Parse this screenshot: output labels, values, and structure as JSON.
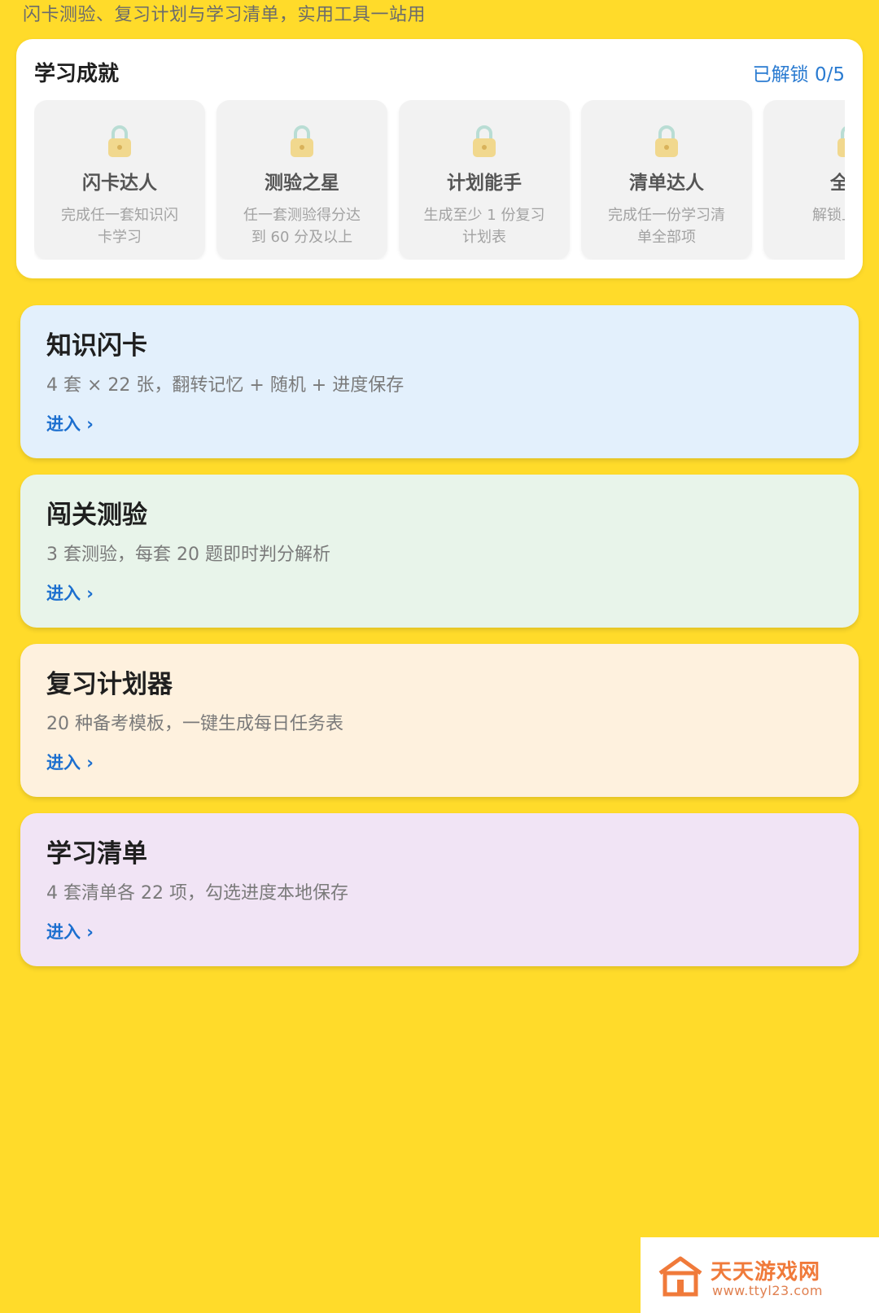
{
  "header": {
    "subtitle": "闪卡测验、复习计划与学习清单，实用工具一站用"
  },
  "achievements": {
    "title": "学习成就",
    "unlocked_label": "已解锁 0/5",
    "items": [
      {
        "name": "闪卡达人",
        "desc": "完成任一套知识闪卡学习"
      },
      {
        "name": "测验之星",
        "desc": "任一套测验得分达到 60 分及以上"
      },
      {
        "name": "计划能手",
        "desc": "生成至少 1 份复习计划表"
      },
      {
        "name": "清单达人",
        "desc": "完成任一份学习清单全部项"
      },
      {
        "name": "全能",
        "desc": "解锁上述成"
      }
    ],
    "locked_icon": "lock-icon"
  },
  "features": [
    {
      "title": "知识闪卡",
      "desc": "4 套 × 22 张，翻转记忆 + 随机 + 进度保存",
      "link": "进入 ›",
      "bg": "#E3F0FC"
    },
    {
      "title": "闯关测验",
      "desc": "3 套测验，每套 20 题即时判分解析",
      "link": "进入 ›",
      "bg": "#E8F4EA"
    },
    {
      "title": "复习计划器",
      "desc": "20 种备考模板，一键生成每日任务表",
      "link": "进入 ›",
      "bg": "#FEF1DE"
    },
    {
      "title": "学习清单",
      "desc": "4 套清单各 22 项，勾选进度本地保存",
      "link": "进入 ›",
      "bg": "#F1E4F5"
    }
  ],
  "watermark": {
    "name": "天天游戏网",
    "url": "www.ttyl23.com"
  },
  "colors": {
    "background": "#FFDB2A",
    "accent": "#1c6fcf"
  }
}
